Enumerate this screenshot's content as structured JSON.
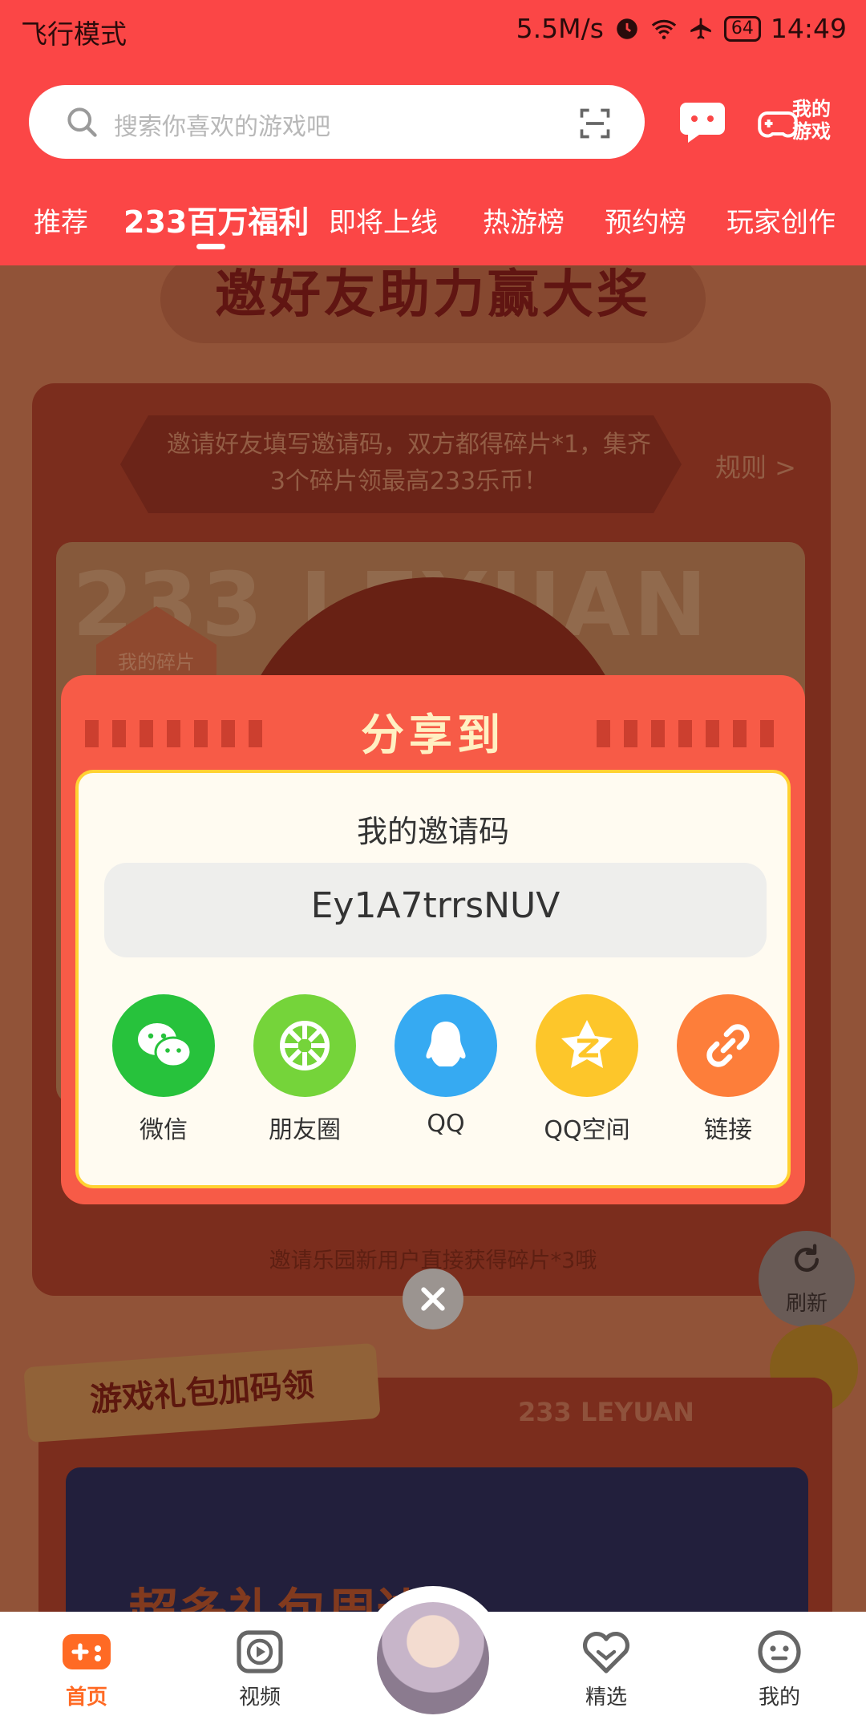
{
  "status_bar": {
    "left": "飞行模式",
    "speed": "5.5M/s",
    "battery": "64",
    "time": "14:49"
  },
  "header": {
    "search_placeholder": "搜索你喜欢的游戏吧",
    "my_games_label": "我的游戏",
    "tabs": [
      "推荐",
      "233百万福利",
      "即将上线",
      "热游榜",
      "预约榜",
      "玩家创作"
    ],
    "active_tab": "233百万福利"
  },
  "background": {
    "banner_title": "邀好友助力赢大奖",
    "rules_text": "邀请好友填写邀请码，双方都得碎片*1，集齐3个碎片领最高233乐币！",
    "rules_link": "规则 >",
    "watermark": "233 LEYUAN",
    "fragment_tag": "我的碎片",
    "invite_hint": "邀请乐园新用户直接获得碎片*3哦",
    "refresh_label": "刷新",
    "gift_title": "游戏礼包加码领",
    "leyuan_mark": "233 LEYUAN",
    "gift_banner_text": "超多礼包周边"
  },
  "modal": {
    "title": "分享到",
    "code_label": "我的邀请码",
    "code_value": "Ey1A7trrsNUV",
    "share_options": [
      {
        "label": "微信",
        "icon": "wechat-icon",
        "color": "#27c23c"
      },
      {
        "label": "朋友圈",
        "icon": "moments-icon",
        "color": "#75d43a"
      },
      {
        "label": "QQ",
        "icon": "qq-icon",
        "color": "#36aaf2"
      },
      {
        "label": "QQ空间",
        "icon": "qzone-icon",
        "color": "#fdc62a"
      },
      {
        "label": "链接",
        "icon": "link-icon",
        "color": "#fd7e3a"
      }
    ]
  },
  "bottom_nav": {
    "items": [
      {
        "label": "首页",
        "icon": "gamepad-icon",
        "active": true
      },
      {
        "label": "视频",
        "icon": "video-icon",
        "active": false
      },
      {
        "label": "精选",
        "icon": "heart-icon",
        "active": false
      },
      {
        "label": "我的",
        "icon": "profile-icon",
        "active": false
      }
    ]
  },
  "colors": {
    "header_red": "#fb4646",
    "modal_red": "#f75b47",
    "nav_active": "#ff6a24"
  }
}
